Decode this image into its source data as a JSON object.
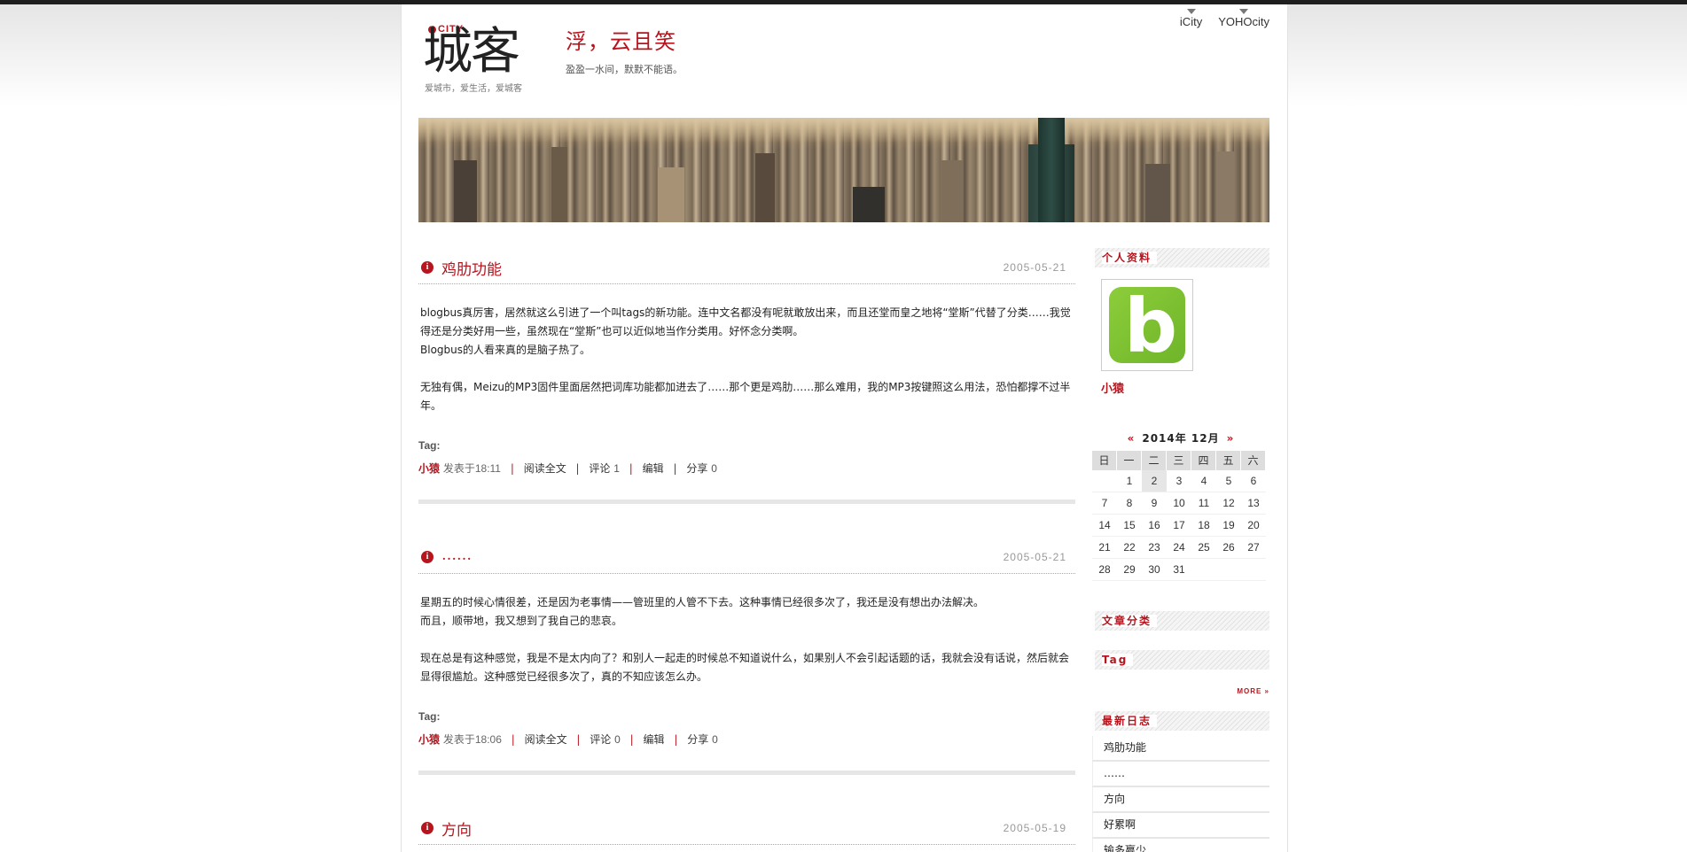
{
  "header": {
    "logo_city": "CITY",
    "logo_i": "i",
    "logo_main": "城客",
    "logo_slogan": "爱城市，爱生活，爱城客",
    "blog_title": "浮，云且笑",
    "blog_subtitle": "盈盈一水间，默默不能语。",
    "top_links": [
      "iCity",
      "YOHOcity"
    ]
  },
  "posts": [
    {
      "title": "鸡肋功能",
      "date": "2005-05-21",
      "paragraphs": [
        "blogbus真厉害，居然就这么引进了一个叫tags的新功能。连中文名都没有呢就敢放出来，而且还堂而皇之地将“堂斯”代替了分类……我觉得还是分类好用一些，虽然现在“堂斯”也可以近似地当作分类用。好怀念分类啊。",
        "Blogbus的人看来真的是脑子热了。",
        "无独有偶，Meizu的MP3固件里面居然把词库功能都加进去了……那个更是鸡肋……那么难用，我的MP3按键照这么用法，恐怕都撑不过半年。"
      ],
      "tag_label": "Tag:",
      "author": "小猿",
      "posted": "发表于18:11",
      "read_more": "阅读全文",
      "comments_label": "评论",
      "comments": "1",
      "edit": "编辑",
      "share_label": "分享",
      "share": "0"
    },
    {
      "title": "……",
      "date": "2005-05-21",
      "paragraphs": [
        "星期五的时候心情很差，还是因为老事情——管班里的人管不下去。这种事情已经很多次了，我还是没有想出办法解决。",
        "而且，顺带地，我又想到了我自己的悲哀。",
        "现在总是有这种感觉，我是不是太内向了？和别人一起走的时候总不知道说什么，如果别人不会引起话题的话，我就会没有话说，然后就会显得很尴尬。这种感觉已经很多次了，真的不知应该怎么办。"
      ],
      "tag_label": "Tag:",
      "author": "小猿",
      "posted": "发表于18:06",
      "read_more": "阅读全文",
      "comments_label": "评论",
      "comments": "0",
      "edit": "编辑",
      "share_label": "分享",
      "share": "0"
    },
    {
      "title": "方向",
      "date": "2005-05-19"
    }
  ],
  "sidebar": {
    "profile_head": "个人资料",
    "profile_name": "小猿",
    "calendar": {
      "title": "2014年 12月",
      "prev": "«",
      "next": "»",
      "weekdays": [
        "日",
        "一",
        "二",
        "三",
        "四",
        "五",
        "六"
      ],
      "weeks": [
        [
          "",
          "1",
          "2",
          "3",
          "4",
          "5",
          "6"
        ],
        [
          "7",
          "8",
          "9",
          "10",
          "11",
          "12",
          "13"
        ],
        [
          "14",
          "15",
          "16",
          "17",
          "18",
          "19",
          "20"
        ],
        [
          "21",
          "22",
          "23",
          "24",
          "25",
          "26",
          "27"
        ],
        [
          "28",
          "29",
          "30",
          "31",
          "",
          "",
          ""
        ]
      ],
      "today": "2"
    },
    "category_head": "文章分类",
    "tag_head": "Tag",
    "more": "MORE »",
    "recent_head": "最新日志",
    "recent": [
      "鸡肋功能",
      "……",
      "方向",
      "好累啊",
      "输多赢少……"
    ]
  },
  "colors": {
    "accent": "#b7151e",
    "topbar": "#1e1e1e",
    "avatar_green": "#7cc232"
  }
}
